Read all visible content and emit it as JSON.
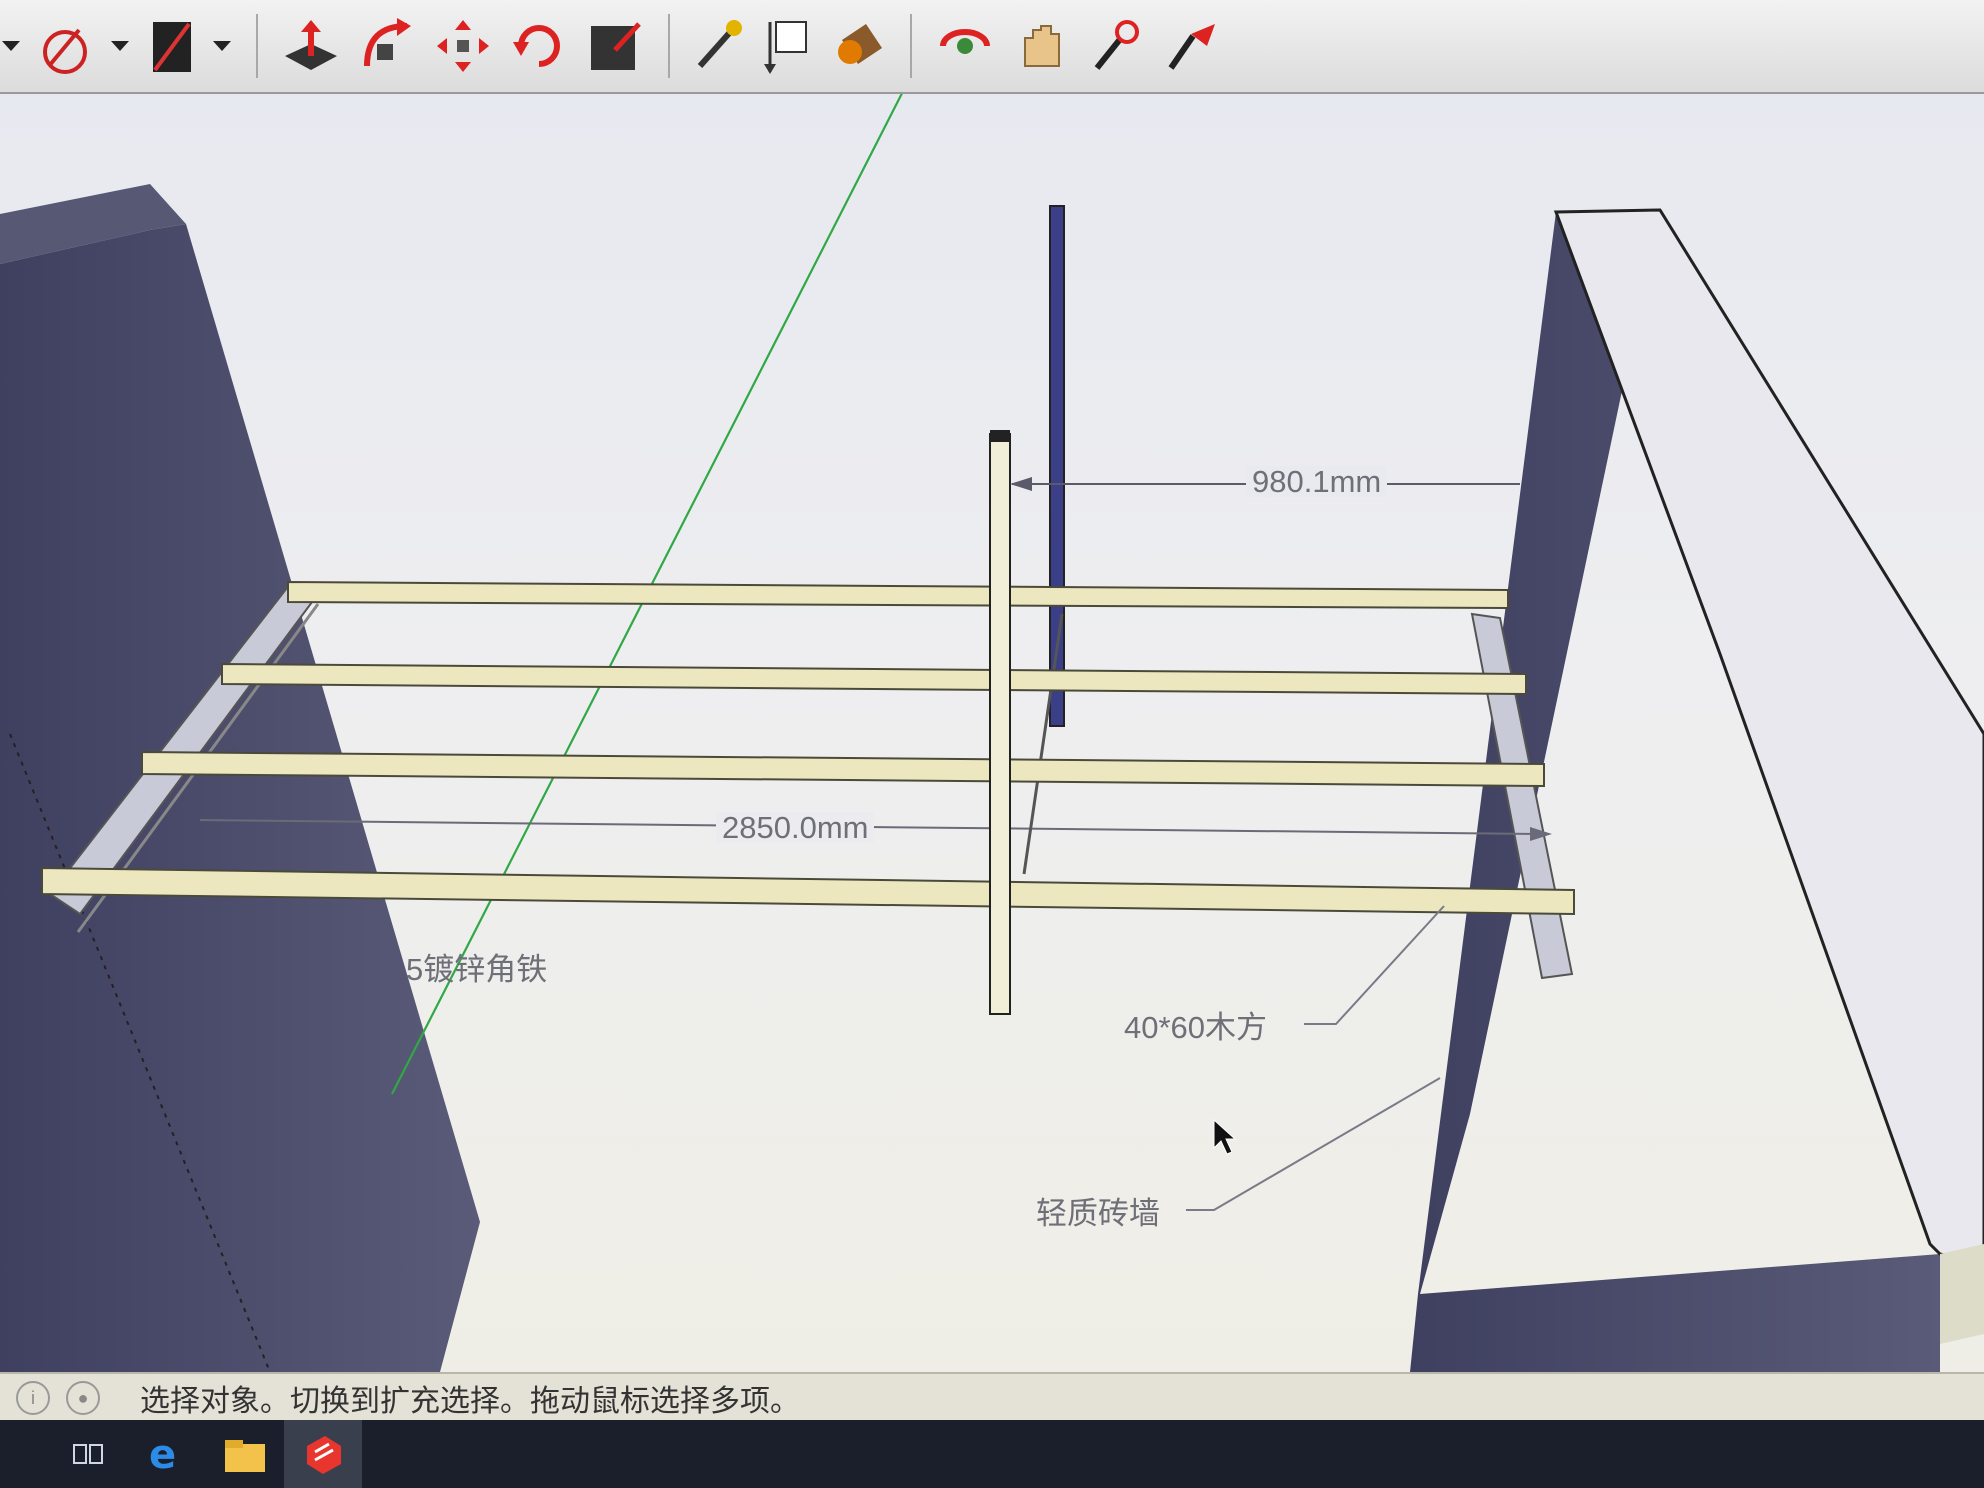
{
  "toolbar": {
    "tools": [
      {
        "name": "arc-tool",
        "icon": "arc-icon"
      },
      {
        "name": "eraser-tool",
        "icon": "eraser-icon"
      },
      {
        "name": "push-pull-tool",
        "icon": "push-pull-icon"
      },
      {
        "name": "follow-me-tool",
        "icon": "follow-me-icon"
      },
      {
        "name": "move-tool",
        "icon": "move-icon"
      },
      {
        "name": "rotate-tool",
        "icon": "rotate-icon"
      },
      {
        "name": "scale-tool",
        "icon": "scale-icon"
      },
      {
        "name": "tape-measure-tool",
        "icon": "tape-measure-icon"
      },
      {
        "name": "dimension-tool",
        "icon": "dimension-icon"
      },
      {
        "name": "paint-bucket-tool",
        "icon": "paint-bucket-icon"
      },
      {
        "name": "orbit-tool",
        "icon": "orbit-icon"
      },
      {
        "name": "pan-tool",
        "icon": "pan-icon"
      }
    ]
  },
  "annotations": {
    "dim_vertical_gap": "980.1mm",
    "dim_span": "2850.0mm",
    "label_angle_iron": "5镀锌角铁",
    "label_timber": "40*60木方",
    "label_wall": "轻质砖墙"
  },
  "status": {
    "message": "选择对象。切换到扩充选择。拖动鼠标选择多项。"
  },
  "taskbar": {
    "items": [
      "task-view-icon",
      "edge-browser-icon",
      "file-explorer-icon",
      "sketchup-icon"
    ]
  },
  "colors": {
    "viewport_bg": "#ecedf0",
    "wall_shadow": "#4a4b66",
    "wall_top": "#e6e6ec",
    "timber": "#ede7c0",
    "green_axis": "#2fa845"
  }
}
